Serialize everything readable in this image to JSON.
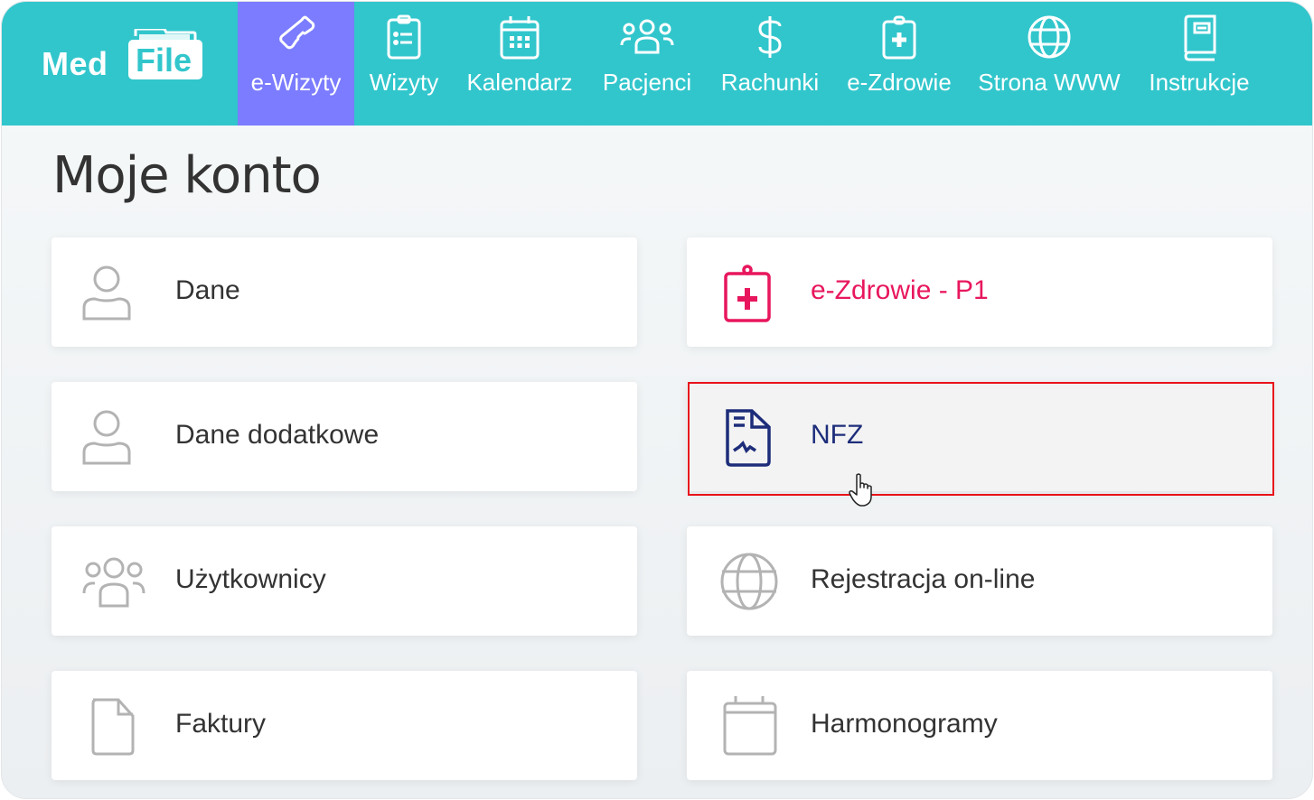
{
  "app": {
    "logo_part1": "Med",
    "logo_part2": "File"
  },
  "nav": {
    "items": [
      {
        "label": "e-Wizyty",
        "icon": "phone-icon",
        "active": true
      },
      {
        "label": "Wizyty",
        "icon": "clipboard-list-icon"
      },
      {
        "label": "Kalendarz",
        "icon": "calendar-icon"
      },
      {
        "label": "Pacjenci",
        "icon": "users-icon"
      },
      {
        "label": "Rachunki",
        "icon": "dollar-icon"
      },
      {
        "label": "e-Zdrowie",
        "icon": "clipboard-medical-icon"
      },
      {
        "label": "Strona WWW",
        "icon": "globe-icon"
      },
      {
        "label": "Instrukcje",
        "icon": "book-icon"
      }
    ]
  },
  "page": {
    "title": "Moje konto"
  },
  "cards": [
    {
      "label": "Dane",
      "icon": "user-icon"
    },
    {
      "label": "e-Zdrowie - P1",
      "icon": "clipboard-medical-icon",
      "color": "#e8175d"
    },
    {
      "label": "Dane dodatkowe",
      "icon": "user-icon"
    },
    {
      "label": "NFZ",
      "icon": "document-signature-icon",
      "color": "#1d2d7a",
      "hovered": true
    },
    {
      "label": "Użytkownicy",
      "icon": "users-icon"
    },
    {
      "label": "Rejestracja on-line",
      "icon": "globe-icon"
    },
    {
      "label": "Faktury",
      "icon": "file-icon"
    },
    {
      "label": "Harmonogramy",
      "icon": "calendar-icon"
    }
  ],
  "colors": {
    "topbar": "#31c6cc",
    "active_nav": "#7b7cff",
    "ezdrowie_accent": "#e8175d",
    "nfz_accent": "#1d2d7a",
    "highlight": "#e8121b",
    "icon_gray": "#b3b3b3"
  }
}
